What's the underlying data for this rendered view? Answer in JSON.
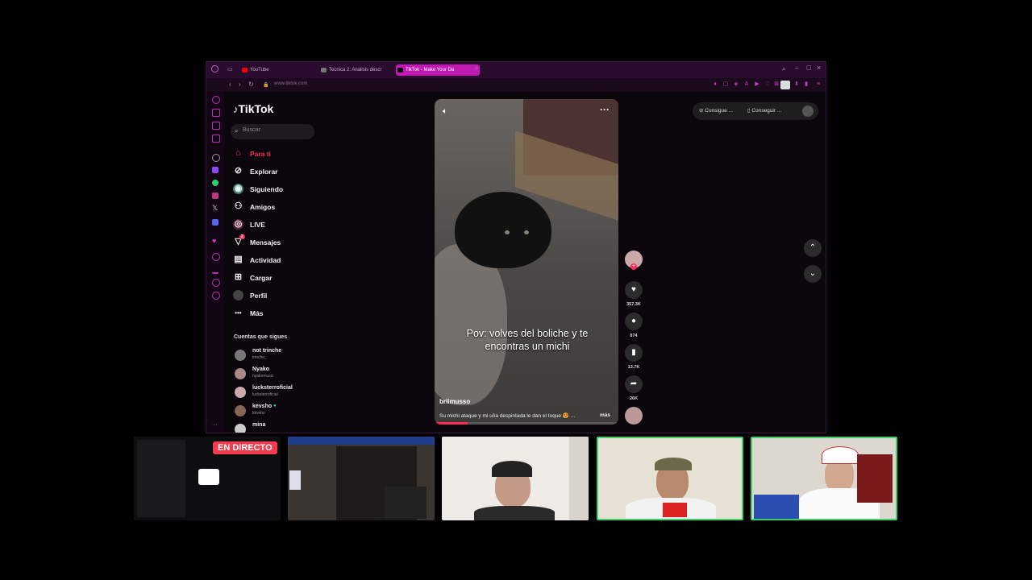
{
  "browser": {
    "tabs": [
      {
        "label": "YouTube",
        "color": "#ff0000"
      },
      {
        "label": "Tecnica 2: Analisis descr",
        "color": "#888888"
      },
      {
        "label": "TikTok - Make Your Da",
        "color": "#000000",
        "active": true
      }
    ],
    "new_tab_glyph": "+",
    "url": "www.tiktok.com",
    "accent": "#c01ab5"
  },
  "tiktok": {
    "logo": "TikTok",
    "search_placeholder": "Buscar",
    "nav": [
      {
        "label": "Para ti",
        "icon": "home-icon",
        "active": true
      },
      {
        "label": "Explorar",
        "icon": "compass-icon"
      },
      {
        "label": "Siguiendo",
        "icon": "following-icon"
      },
      {
        "label": "Amigos",
        "icon": "friends-icon"
      },
      {
        "label": "LIVE",
        "icon": "live-icon"
      },
      {
        "label": "Mensajes",
        "icon": "messages-icon",
        "badge": "2"
      },
      {
        "label": "Actividad",
        "icon": "activity-icon"
      },
      {
        "label": "Cargar",
        "icon": "upload-icon"
      },
      {
        "label": "Perfil",
        "icon": "profile-icon"
      },
      {
        "label": "Más",
        "icon": "more-icon"
      }
    ],
    "following_header": "Cuentas que sigues",
    "following": [
      {
        "name": "not trinche",
        "handle": "trinche_"
      },
      {
        "name": "Nyako",
        "handle": "nyakomusic"
      },
      {
        "name": "lucksterroficial",
        "handle": "lucksterroficial"
      },
      {
        "name": "kevsho",
        "handle": "kevsho",
        "verified": true
      },
      {
        "name": "mina",
        "handle": ""
      }
    ],
    "video": {
      "caption": "Pov: volves del boliche y te encontras un michi",
      "username": "briimusso",
      "description": "Su michi ataque y mi uña despintada le dan el toque 😍 ...",
      "more_label": "más",
      "progress": 0.18
    },
    "actions": [
      {
        "icon": "heart-icon",
        "label": "357.3K"
      },
      {
        "icon": "comment-icon",
        "label": "874"
      },
      {
        "icon": "bookmark-icon",
        "label": "13.7K"
      },
      {
        "icon": "share-icon",
        "label": "26K"
      }
    ],
    "top_pills": [
      "Consigue ...",
      "Conseguir ..."
    ]
  },
  "stream": {
    "live_badge": "EN DIRECTO",
    "cams": 5
  }
}
